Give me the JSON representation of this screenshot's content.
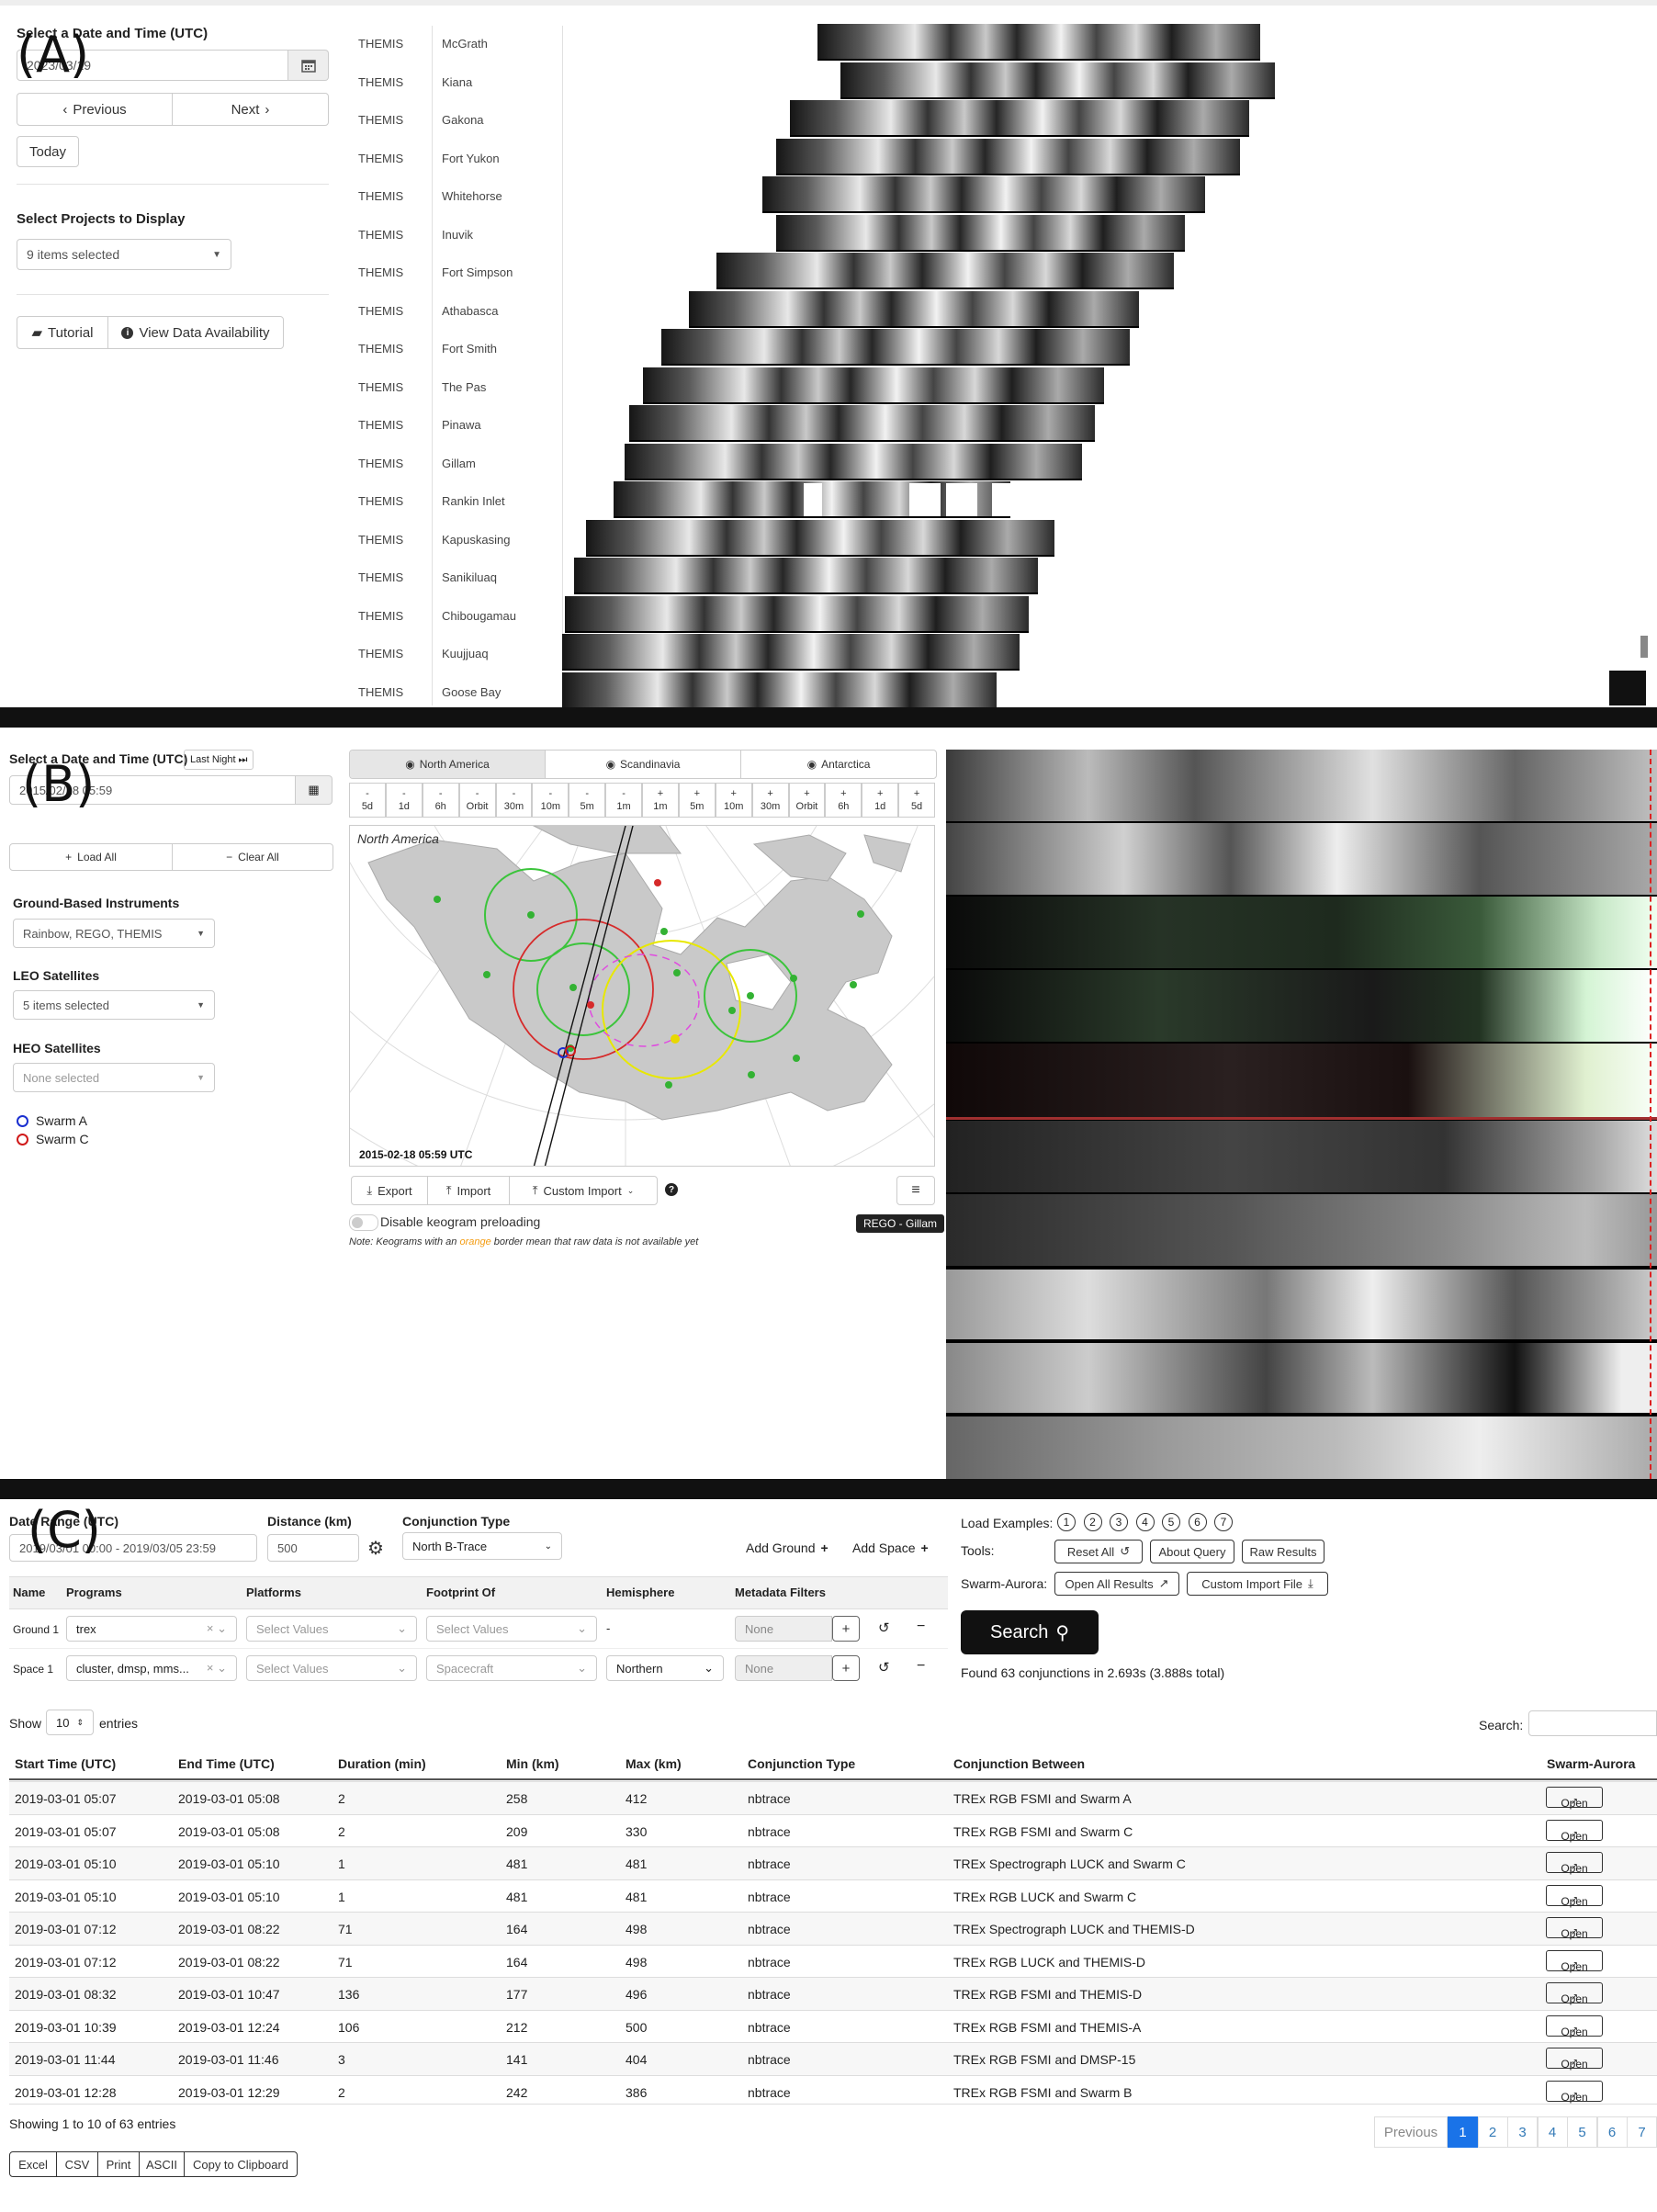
{
  "panel_labels": {
    "a": "(A)",
    "b": "(B)",
    "c": "(C)"
  },
  "panel_a": {
    "date_label": "Select a Date and Time (UTC)",
    "date_value": "2023/03/19",
    "prev_label": "Previous",
    "next_label": "Next",
    "today_label": "Today",
    "projects_label": "Select Projects to Display",
    "projects_value": "9 items selected",
    "tutorial_label": "Tutorial",
    "availability_label": "View Data Availability",
    "rows": [
      {
        "project": "THEMIS",
        "site": "McGrath"
      },
      {
        "project": "THEMIS",
        "site": "Kiana"
      },
      {
        "project": "THEMIS",
        "site": "Gakona"
      },
      {
        "project": "THEMIS",
        "site": "Fort Yukon"
      },
      {
        "project": "THEMIS",
        "site": "Whitehorse"
      },
      {
        "project": "THEMIS",
        "site": "Inuvik"
      },
      {
        "project": "THEMIS",
        "site": "Fort Simpson"
      },
      {
        "project": "THEMIS",
        "site": "Athabasca"
      },
      {
        "project": "THEMIS",
        "site": "Fort Smith"
      },
      {
        "project": "THEMIS",
        "site": "The Pas"
      },
      {
        "project": "THEMIS",
        "site": "Pinawa"
      },
      {
        "project": "THEMIS",
        "site": "Gillam"
      },
      {
        "project": "THEMIS",
        "site": "Rankin Inlet"
      },
      {
        "project": "THEMIS",
        "site": "Kapuskasing"
      },
      {
        "project": "THEMIS",
        "site": "Sanikiluaq"
      },
      {
        "project": "THEMIS",
        "site": "Chibougamau"
      },
      {
        "project": "THEMIS",
        "site": "Kuujjuaq"
      },
      {
        "project": "THEMIS",
        "site": "Goose Bay"
      }
    ]
  },
  "panel_b": {
    "date_label": "Select a Date and Time (UTC)",
    "last_night_label": "Last Night",
    "date_value": "2015/02/18 05:59",
    "load_all": "Load All",
    "clear_all": "Clear All",
    "ground_label": "Ground-Based Instruments",
    "ground_value": "Rainbow, REGO, THEMIS",
    "leo_label": "LEO Satellites",
    "leo_value": "5 items selected",
    "heo_label": "HEO Satellites",
    "heo_value": "None selected",
    "legend": [
      {
        "name": "Swarm A",
        "color": "#1a2fd0"
      },
      {
        "name": "Swarm C",
        "color": "#d01a1a"
      }
    ],
    "regions": [
      "North America",
      "Scandinavia",
      "Antarctica"
    ],
    "steps": [
      {
        "sign": "-",
        "v": "5d"
      },
      {
        "sign": "-",
        "v": "1d"
      },
      {
        "sign": "-",
        "v": "6h"
      },
      {
        "sign": "-",
        "v": "Orbit"
      },
      {
        "sign": "-",
        "v": "30m"
      },
      {
        "sign": "-",
        "v": "10m"
      },
      {
        "sign": "-",
        "v": "5m"
      },
      {
        "sign": "-",
        "v": "1m"
      },
      {
        "sign": "+",
        "v": "1m"
      },
      {
        "sign": "+",
        "v": "5m"
      },
      {
        "sign": "+",
        "v": "10m"
      },
      {
        "sign": "+",
        "v": "30m"
      },
      {
        "sign": "+",
        "v": "Orbit"
      },
      {
        "sign": "+",
        "v": "6h"
      },
      {
        "sign": "+",
        "v": "1d"
      },
      {
        "sign": "+",
        "v": "5d"
      }
    ],
    "map_title": "North America",
    "map_timestamp": "2015-02-18 05:59 UTC",
    "export": "Export",
    "import": "Import",
    "custom_import": "Custom Import",
    "preload_label": "Disable keogram preloading",
    "note_prefix": "Note: Keograms with an ",
    "note_orange": "orange",
    "note_suffix": " border mean that raw data is not available yet",
    "tooltip": "REGO - Gillam"
  },
  "panel_c": {
    "date_range_label": "Date Range (UTC)",
    "date_range_value": "2019/03/01 00:00 - 2019/03/05 23:59",
    "distance_label": "Distance (km)",
    "distance_value": "500",
    "conj_type_label": "Conjunction Type",
    "conj_type_value": "North B-Trace",
    "add_ground": "Add Ground",
    "add_space": "Add Space",
    "filter_headers": [
      "Name",
      "Programs",
      "Platforms",
      "Footprint Of",
      "Hemisphere",
      "Metadata Filters"
    ],
    "ground_row": {
      "name": "Ground 1",
      "programs": "trex",
      "platforms": "Select Values",
      "footprint": "Select Values",
      "hemisphere": "-",
      "metadata": "None"
    },
    "space_row": {
      "name": "Space 1",
      "programs": "cluster, dmsp, mms...",
      "platforms": "Select Values",
      "footprint": "Spacecraft",
      "hemisphere": "Northern",
      "metadata": "None"
    },
    "load_examples_label": "Load Examples:",
    "examples": [
      "1",
      "2",
      "3",
      "4",
      "5",
      "6",
      "7"
    ],
    "tools_label": "Tools:",
    "reset_all": "Reset All",
    "about_query": "About Query",
    "raw_results": "Raw Results",
    "swarm_label": "Swarm-Aurora:",
    "open_all": "Open All Results",
    "custom_import_file": "Custom Import File",
    "search_btn": "Search",
    "found_text": "Found 63 conjunctions in 2.693s (3.888s total)",
    "show_label": "Show",
    "show_value": "10",
    "entries_label": "entries",
    "search_label": "Search:",
    "columns": [
      "Start Time (UTC)",
      "End Time (UTC)",
      "Duration (min)",
      "Min (km)",
      "Max (km)",
      "Conjunction Type",
      "Conjunction Between",
      "Swarm-Aurora"
    ],
    "rows": [
      [
        "2019-03-01 05:07",
        "2019-03-01 05:08",
        "2",
        "258",
        "412",
        "nbtrace",
        "TREx RGB FSMI and Swarm A"
      ],
      [
        "2019-03-01 05:07",
        "2019-03-01 05:08",
        "2",
        "209",
        "330",
        "nbtrace",
        "TREx RGB FSMI and Swarm C"
      ],
      [
        "2019-03-01 05:10",
        "2019-03-01 05:10",
        "1",
        "481",
        "481",
        "nbtrace",
        "TREx Spectrograph LUCK and Swarm C"
      ],
      [
        "2019-03-01 05:10",
        "2019-03-01 05:10",
        "1",
        "481",
        "481",
        "nbtrace",
        "TREx RGB LUCK and Swarm C"
      ],
      [
        "2019-03-01 07:12",
        "2019-03-01 08:22",
        "71",
        "164",
        "498",
        "nbtrace",
        "TREx Spectrograph LUCK and THEMIS-D"
      ],
      [
        "2019-03-01 07:12",
        "2019-03-01 08:22",
        "71",
        "164",
        "498",
        "nbtrace",
        "TREx RGB LUCK and THEMIS-D"
      ],
      [
        "2019-03-01 08:32",
        "2019-03-01 10:47",
        "136",
        "177",
        "496",
        "nbtrace",
        "TREx RGB FSMI and THEMIS-D"
      ],
      [
        "2019-03-01 10:39",
        "2019-03-01 12:24",
        "106",
        "212",
        "500",
        "nbtrace",
        "TREx RGB FSMI and THEMIS-A"
      ],
      [
        "2019-03-01 11:44",
        "2019-03-01 11:46",
        "3",
        "141",
        "404",
        "nbtrace",
        "TREx RGB FSMI and DMSP-15"
      ],
      [
        "2019-03-01 12:28",
        "2019-03-01 12:29",
        "2",
        "242",
        "386",
        "nbtrace",
        "TREx RGB FSMI and Swarm B"
      ]
    ],
    "open_label": "Open",
    "showing_text": "Showing 1 to 10 of 63 entries",
    "prev_page": "Previous",
    "pages": [
      "1",
      "2",
      "3",
      "4",
      "5",
      "6",
      "7"
    ],
    "export_buttons": [
      "Excel",
      "CSV",
      "Print",
      "ASCII",
      "Copy to Clipboard"
    ]
  }
}
